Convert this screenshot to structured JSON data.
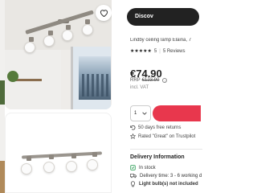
{
  "header": {
    "discover_label": "Discov"
  },
  "product": {
    "title": "Lindby ceiling lamp Elaina, 7",
    "stars": "★★★★★",
    "rating": "5",
    "reviews": "5 Reviews",
    "price": "€74.90",
    "rrp_label": "RRP",
    "rrp_value": "€123.90",
    "vat_note": "incl. VAT",
    "quantity": "1"
  },
  "perks": [
    {
      "text": "50 days free returns"
    },
    {
      "text": "Rated \"Great\" on Trustpilot"
    }
  ],
  "delivery": {
    "title": "Delivery Information",
    "stock": "In stock",
    "time": "Delivery time: 3 - 6 working d",
    "bulbs": "Light bulb(s) not included"
  },
  "colors": {
    "accent": "#e8374d",
    "dark_button": "#222222",
    "stock_green": "#2e9e57"
  },
  "icons": [
    "heart-icon",
    "info-icon",
    "chevron-down-icon",
    "return-icon",
    "star-icon",
    "box-icon",
    "truck-icon",
    "bulb-icon"
  ]
}
